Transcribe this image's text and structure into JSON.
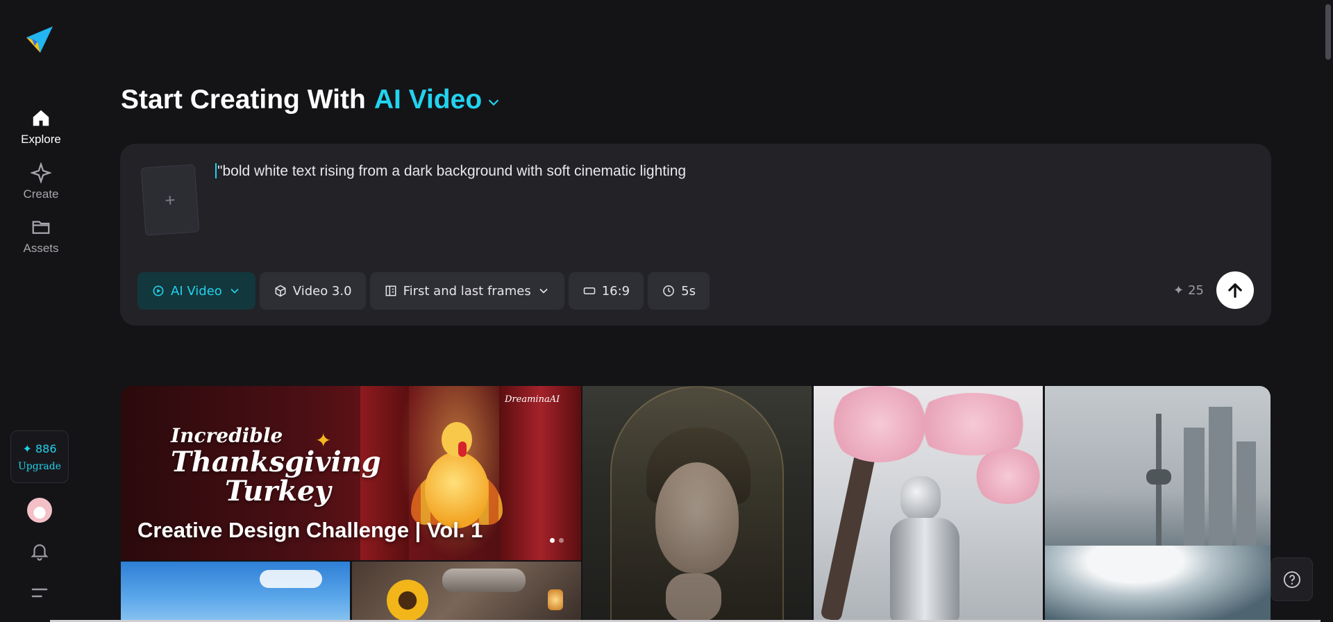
{
  "sidebar": {
    "nav": [
      {
        "label": "Explore",
        "icon": "home-icon",
        "active": true
      },
      {
        "label": "Create",
        "icon": "diamond-icon",
        "active": false
      },
      {
        "label": "Assets",
        "icon": "folder-icon",
        "active": false
      }
    ],
    "credits": {
      "count": "886",
      "star": "✦",
      "upgrade_label": "Upgrade"
    }
  },
  "header": {
    "title_prefix": "Start Creating With",
    "title_accent": "AI Video"
  },
  "composer": {
    "upload_plus": "+",
    "prompt": "\"bold white text rising from a dark background with soft cinematic lighting",
    "chips": {
      "mode": "AI Video",
      "model": "Video 3.0",
      "frames": "First and last frames",
      "ratio": "16:9",
      "duration": "5s"
    },
    "cost": "25",
    "cost_star": "✦"
  },
  "gallery": {
    "banner": {
      "headline_line1": "Incredible",
      "headline_line2": "Thanksgiving",
      "headline_line3": "Turkey",
      "brand": "DreaminaAI",
      "title": "Creative Design Challenge | Vol. 1",
      "slides": 2,
      "active_slide": 1
    }
  },
  "colors": {
    "background": "#141417",
    "panel": "#222227",
    "accent": "#22d3ee",
    "chip": "#2e2e35"
  }
}
